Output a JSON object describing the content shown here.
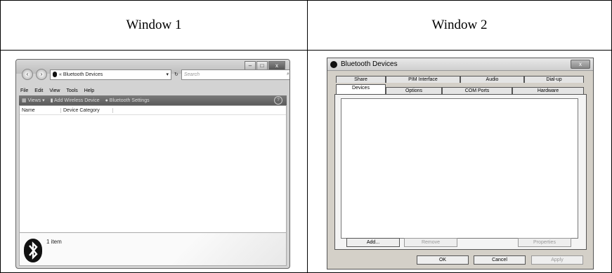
{
  "headers": {
    "window1": "Window 1",
    "window2": "Window 2"
  },
  "window1": {
    "caption_buttons": [
      "–",
      "□",
      "x"
    ],
    "address_path": "« Bluetooth Devices",
    "search_placeholder": "Search",
    "menu": [
      "File",
      "Edit",
      "View",
      "Tools",
      "Help"
    ],
    "toolbar": {
      "views": "Views",
      "add_device": "Add Wireless Device",
      "settings": "Bluetooth Settings"
    },
    "columns": [
      "Name",
      "Device Category"
    ],
    "item_count": "1 item"
  },
  "window2": {
    "title": "Bluetooth Devices",
    "close_label": "x",
    "tabs_back": [
      "Share",
      "PIM Interface",
      "Audio",
      "Dial-up"
    ],
    "tabs_front": [
      "Devices",
      "Options",
      "COM Ports",
      "Hardware"
    ],
    "buttons": {
      "add": "Add...",
      "remove": "Remove",
      "properties": "Properties",
      "ok": "OK",
      "cancel": "Cancel",
      "apply": "Apply"
    }
  }
}
